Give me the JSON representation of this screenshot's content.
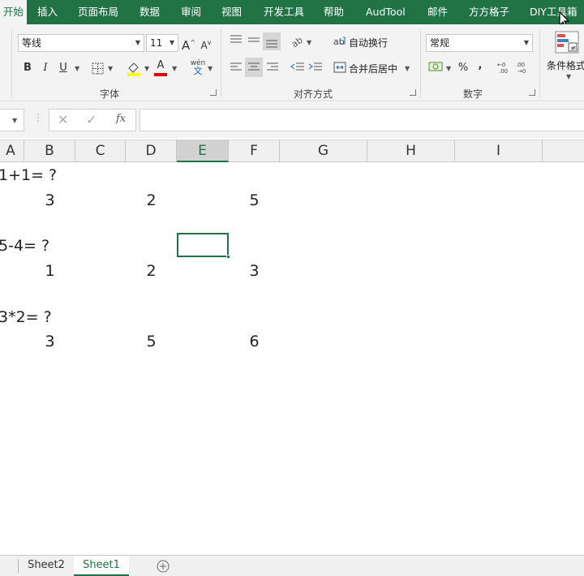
{
  "ribbon_tabs": [
    {
      "label": "开始",
      "active": true
    },
    {
      "label": "插入"
    },
    {
      "label": "页面布局"
    },
    {
      "label": "数据"
    },
    {
      "label": "审阅"
    },
    {
      "label": "视图"
    },
    {
      "label": "开发工具"
    },
    {
      "label": "帮助"
    },
    {
      "label": "AudTool"
    },
    {
      "label": "邮件"
    },
    {
      "label": "方方格子"
    },
    {
      "label": "DIY工具箱"
    }
  ],
  "font_group": {
    "font_name": "等线",
    "font_size": "11",
    "grow_label": "A",
    "shrink_label": "A",
    "bold": "B",
    "italic": "I",
    "underline": "U",
    "font_color_label": "A",
    "phonetic_top": "wén",
    "phonetic_bottom": "文",
    "label": "字体"
  },
  "align_group": {
    "wrap_text": "自动换行",
    "merge_center": "合并后居中",
    "label": "对齐方式"
  },
  "number_group": {
    "format": "常规",
    "percent": "%",
    "comma": ",",
    "label": "数字"
  },
  "styles_group": {
    "conditional_format": "条件格式"
  },
  "formula_bar": {
    "fx": "fx",
    "value": ""
  },
  "columns": [
    "A",
    "B",
    "C",
    "D",
    "E",
    "F",
    "G",
    "H",
    "I"
  ],
  "selected_column": "E",
  "cells": {
    "r1_a": "1+1= ?",
    "r2_b": "3",
    "r2_d": "2",
    "r2_f": "5",
    "r4_a": "5-4= ?",
    "r5_b": "1",
    "r5_d": "2",
    "r5_f": "3",
    "r7_a": "3*2= ?",
    "r8_b": "3",
    "r8_d": "5",
    "r8_f": "6"
  },
  "sheets": [
    {
      "label": "Sheet2"
    },
    {
      "label": "Sheet1",
      "active": true
    }
  ],
  "colors": {
    "accent": "#217346",
    "ribbon_bg": "#f3f3f3",
    "header_bg": "#f0f0f0"
  }
}
